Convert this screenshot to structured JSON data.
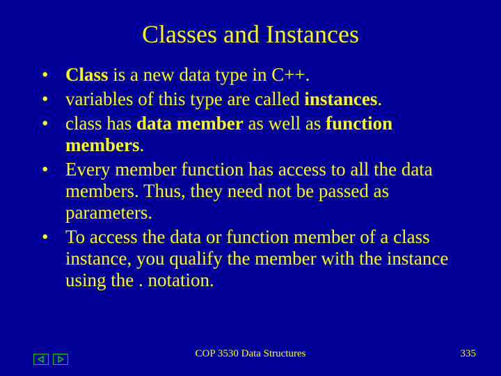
{
  "title": "Classes and Instances",
  "bullets": {
    "b1": {
      "t1": "Class",
      "t2": " is a new data type in C++."
    },
    "b2": {
      "t1": "variables of this type are called ",
      "t2": "instances",
      "t3": "."
    },
    "b3": {
      "t1": "class has ",
      "t2": "data member",
      "t3": " as well as ",
      "t4": "function members",
      "t5": "."
    },
    "b4": {
      "t1": "Every member function has access to all the data members. Thus, they need not be passed as parameters."
    },
    "b5": {
      "t1": "To access the data or function member of a class instance, you qualify the member with the instance using the . notation."
    }
  },
  "footer": {
    "center": "COP 3530 Data Structures",
    "page": "335"
  },
  "nav": {
    "prev": "prev-button",
    "next": "next-button"
  }
}
